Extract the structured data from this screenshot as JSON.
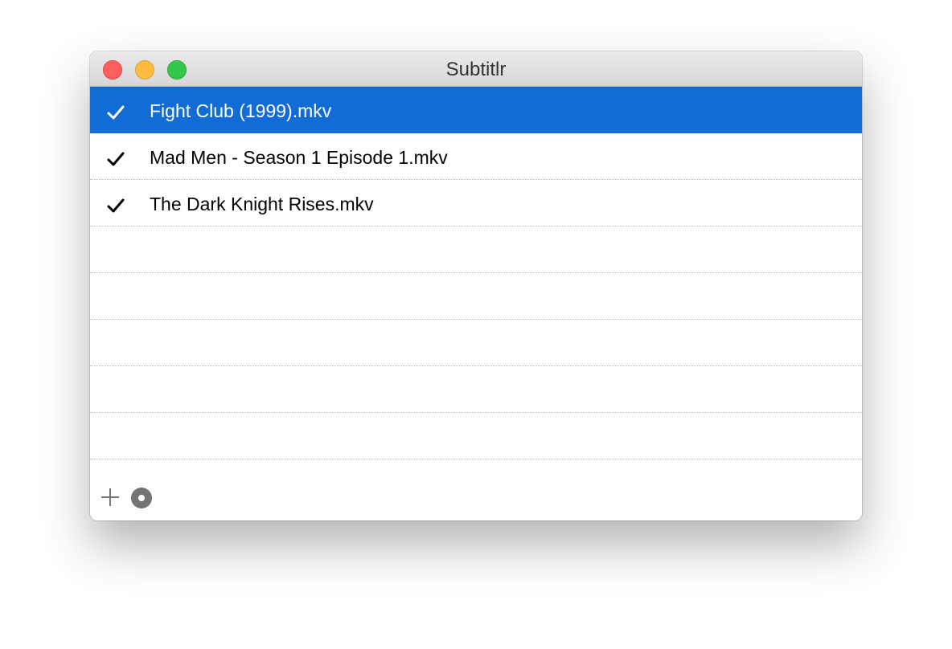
{
  "window": {
    "title": "Subtitlr"
  },
  "traffic_lights": {
    "close_color": "#fc605c",
    "minimize_color": "#fdbc40",
    "zoom_color": "#34c84a"
  },
  "colors": {
    "selection": "#116cd6",
    "selected_text": "#ffffff",
    "text": "#000000",
    "toolbar_icon": "#747474"
  },
  "files": [
    {
      "name": "Fight Club (1999).mkv",
      "checked": true,
      "selected": true
    },
    {
      "name": "Mad Men - Season 1 Episode 1.mkv",
      "checked": true,
      "selected": false
    },
    {
      "name": "The Dark Knight Rises.mkv",
      "checked": true,
      "selected": false
    }
  ],
  "empty_rows": 5,
  "toolbar": {
    "add_icon": "plus-icon",
    "settings_icon": "gear-icon"
  }
}
